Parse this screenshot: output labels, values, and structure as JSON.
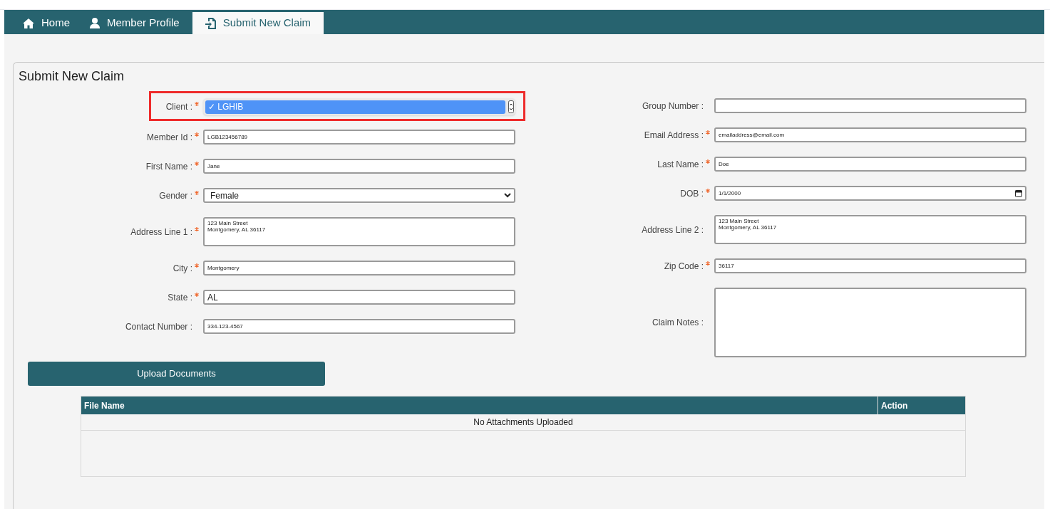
{
  "tabs": [
    {
      "label": "Home",
      "selected": false
    },
    {
      "label": "Member Profile",
      "selected": false
    },
    {
      "label": "Submit New Claim",
      "selected": true
    }
  ],
  "panel": {
    "title": "Submit New Claim"
  },
  "form": {
    "left": [
      {
        "label": "Client :",
        "required": true,
        "kind": "open-select",
        "value": "✓ LGHIB",
        "highlighted": true
      },
      {
        "label": "Member Id :",
        "required": true,
        "kind": "text",
        "value": "LGB123456789"
      },
      {
        "label": "First Name :",
        "required": true,
        "kind": "text",
        "value": "Jane"
      },
      {
        "label": "Gender :",
        "required": true,
        "kind": "select",
        "value": "Female"
      },
      {
        "label": "Address Line 1 :",
        "required": true,
        "kind": "textarea",
        "value": "123 Main Street\nMontgomery, AL 36117"
      },
      {
        "label": "City :",
        "required": true,
        "kind": "text",
        "value": "Montgomery"
      },
      {
        "label": "State :",
        "required": true,
        "kind": "large-text",
        "value": "AL"
      },
      {
        "label": "Contact Number :",
        "required": false,
        "kind": "text",
        "value": "334-123-4567"
      }
    ],
    "right": [
      {
        "label": "Group Number :",
        "required": false,
        "kind": "text"
      },
      {
        "label": "Email Address :",
        "required": true,
        "kind": "text",
        "value": "emailaddress@email.com"
      },
      {
        "label": "Last Name :",
        "required": true,
        "kind": "text",
        "value": "Doe"
      },
      {
        "label": "DOB :",
        "required": true,
        "kind": "date",
        "value": "1/1/2000"
      },
      {
        "label": "Address Line 2 :",
        "required": false,
        "kind": "textarea",
        "value": "123 Main Street\nMontgomery, AL 36117"
      },
      {
        "label": "Zip Code :",
        "required": true,
        "kind": "text",
        "value": "36117"
      },
      {
        "label": "Claim Notes :",
        "required": false,
        "kind": "notes"
      }
    ]
  },
  "upload_button": "Upload Documents",
  "table": {
    "columns": [
      "File Name",
      "Action"
    ],
    "empty_message": "No Attachments Uploaded"
  }
}
